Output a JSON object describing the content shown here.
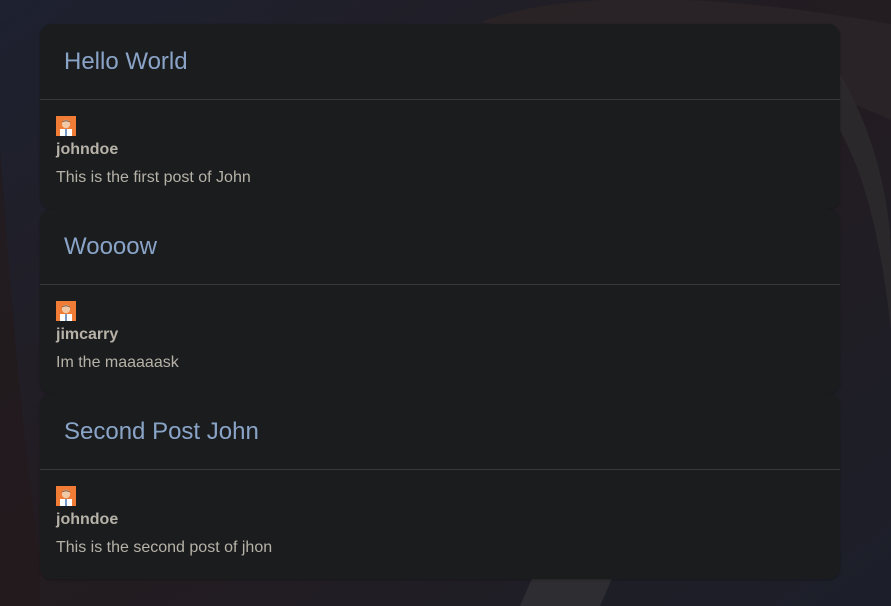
{
  "posts": [
    {
      "title": "Hello World",
      "author": "johndoe",
      "avatar_icon": "user-avatar-icon",
      "content": "This is the first post of John"
    },
    {
      "title": "Woooow",
      "author": "jimcarry",
      "avatar_icon": "user-avatar-icon",
      "content": "Im the maaaaask"
    },
    {
      "title": "Second Post John",
      "author": "johndoe",
      "avatar_icon": "user-avatar-icon",
      "content": "This is the second post of jhon"
    }
  ],
  "colors": {
    "background": "#1b1a20",
    "card": "#1b1c1e",
    "divider": "#36383b",
    "title": "#8aa4c8",
    "text": "#b6b2a8",
    "avatar_orange": "#f07c35"
  }
}
